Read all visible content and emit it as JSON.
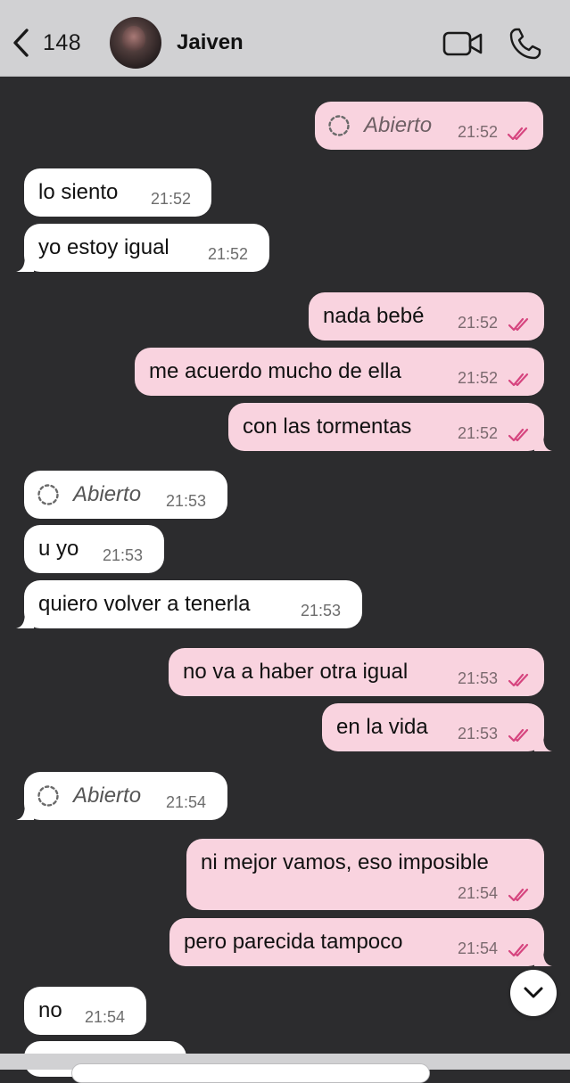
{
  "header": {
    "back_count": "148",
    "contact_name": "Jaiven",
    "avatar_icon": "contact-avatar",
    "video_icon": "video-camera-icon",
    "phone_icon": "phone-icon"
  },
  "messages": [
    {
      "dir": "out",
      "type": "open",
      "text": "Abierto",
      "time": "21:52"
    },
    {
      "dir": "in",
      "type": "text",
      "text": "lo siento",
      "time": "21:52"
    },
    {
      "dir": "in",
      "type": "text",
      "text": "yo estoy igual",
      "time": "21:52"
    },
    {
      "dir": "out",
      "type": "text",
      "text": "nada bebé",
      "time": "21:52"
    },
    {
      "dir": "out",
      "type": "text",
      "text": "me acuerdo mucho de ella",
      "time": "21:52"
    },
    {
      "dir": "out",
      "type": "text",
      "text": "con las tormentas",
      "time": "21:52"
    },
    {
      "dir": "in",
      "type": "open",
      "text": "Abierto",
      "time": "21:53"
    },
    {
      "dir": "in",
      "type": "text",
      "text": "u yo",
      "time": "21:53"
    },
    {
      "dir": "in",
      "type": "text",
      "text": "quiero volver a tenerla",
      "time": "21:53"
    },
    {
      "dir": "out",
      "type": "text",
      "text": "no va a haber otra igual",
      "time": "21:53"
    },
    {
      "dir": "out",
      "type": "text",
      "text": "en la vida",
      "time": "21:53"
    },
    {
      "dir": "in",
      "type": "open",
      "text": "Abierto",
      "time": "21:54"
    },
    {
      "dir": "out",
      "type": "text",
      "text": "ni mejor vamos, eso imposible",
      "time": "21:54"
    },
    {
      "dir": "out",
      "type": "text",
      "text": "pero parecida tampoco",
      "time": "21:54"
    },
    {
      "dir": "in",
      "type": "text",
      "text": "no",
      "time": "21:54"
    }
  ],
  "colors": {
    "chat_background": "#2c2c2e",
    "incoming_bubble": "#ffffff",
    "outgoing_bubble": "#f9d3df",
    "read_ticks": "#d6457f",
    "header_background": "#d1d1d3"
  },
  "scroll_button_icon": "chevron-down-icon"
}
